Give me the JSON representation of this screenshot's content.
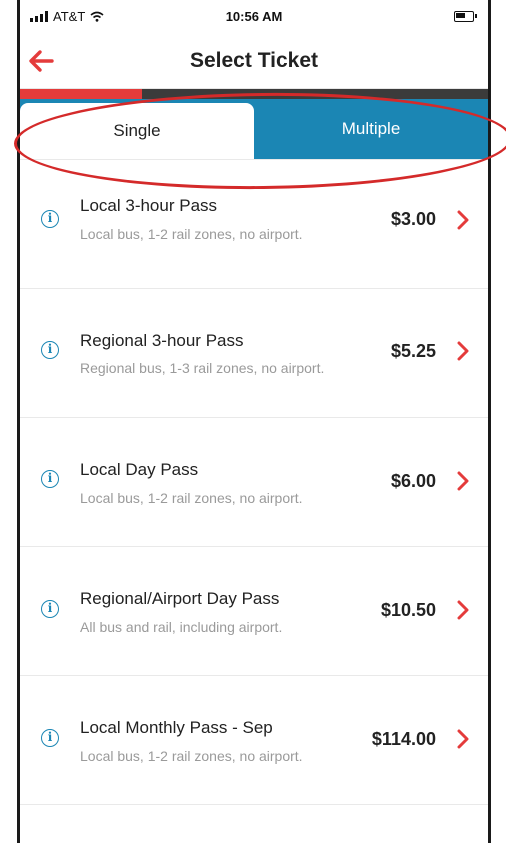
{
  "status": {
    "carrier": "AT&T",
    "time": "10:56 AM"
  },
  "nav": {
    "title": "Select Ticket"
  },
  "progress": {
    "fraction": 0.26
  },
  "tabs": [
    {
      "label": "Single",
      "active": true
    },
    {
      "label": "Multiple",
      "active": false
    }
  ],
  "tickets": [
    {
      "name": "Local 3-hour Pass",
      "description": "Local bus, 1-2 rail zones, no airport.",
      "price": "$3.00"
    },
    {
      "name": "Regional 3-hour Pass",
      "description": "Regional bus, 1-3 rail zones, no airport.",
      "price": "$5.25"
    },
    {
      "name": "Local Day Pass",
      "description": "Local bus, 1-2 rail zones, no airport.",
      "price": "$6.00"
    },
    {
      "name": "Regional/Airport Day Pass",
      "description": "All bus and rail, including airport.",
      "price": "$10.50"
    },
    {
      "name": "Local Monthly Pass - Sep",
      "description": "Local bus, 1-2 rail zones, no airport.",
      "price": "$114.00"
    }
  ],
  "colors": {
    "accent": "#1b86b4",
    "brand_red": "#e43b3b",
    "annotation": "#d42a2a"
  }
}
